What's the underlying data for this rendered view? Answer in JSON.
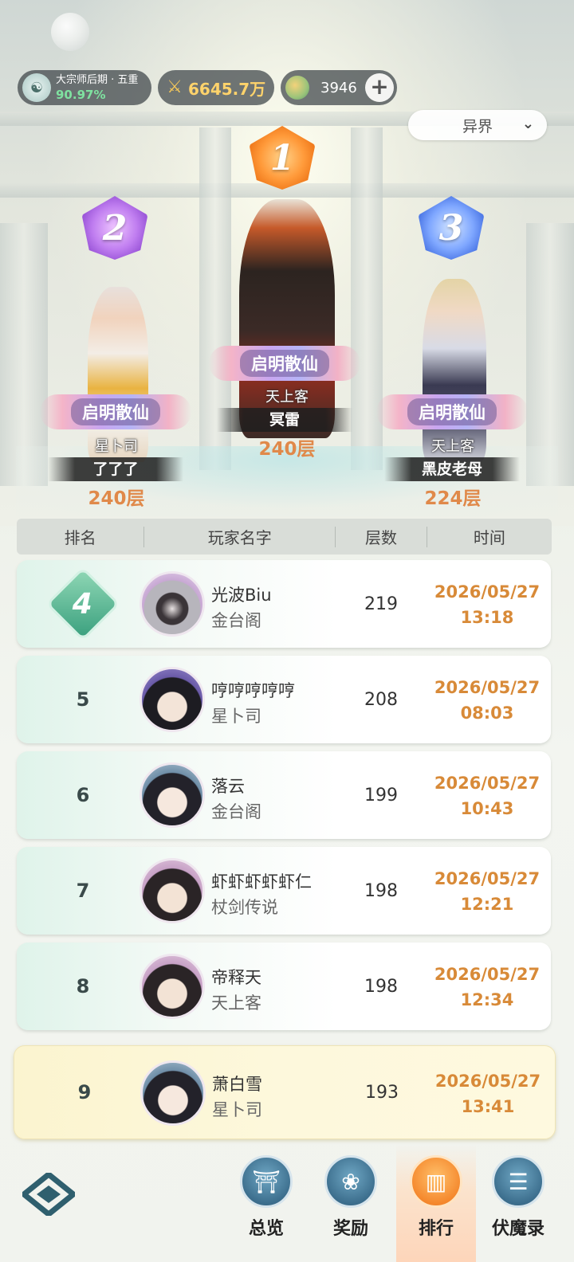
{
  "status_bar": {
    "realm_name": "大宗师后期 · 五重",
    "realm_progress": "90.97%",
    "combat_power": "6645.7万",
    "currency_amount": "3946",
    "add_label": "+"
  },
  "realm_selector": {
    "selected": "异界"
  },
  "podium": [
    {
      "rank": "1",
      "title": "启明散仙",
      "sect": "天上客",
      "player": "冥雷",
      "floor": "240层"
    },
    {
      "rank": "2",
      "title": "启明散仙",
      "sect": "星卜司",
      "player": "了了了",
      "floor": "240层"
    },
    {
      "rank": "3",
      "title": "启明散仙",
      "sect": "天上客",
      "player": "黑皮老母",
      "floor": "224层"
    }
  ],
  "table": {
    "headers": {
      "rank": "排名",
      "name": "玩家名字",
      "floor": "层数",
      "time": "时间"
    },
    "rows": [
      {
        "rank": "4",
        "name": "光波Biu",
        "sect": "金台阁",
        "floor": "219",
        "date": "2026/05/27",
        "clock": "13:18"
      },
      {
        "rank": "5",
        "name": "哼哼哼哼哼",
        "sect": "星卜司",
        "floor": "208",
        "date": "2026/05/27",
        "clock": "08:03"
      },
      {
        "rank": "6",
        "name": "落云",
        "sect": "金台阁",
        "floor": "199",
        "date": "2026/05/27",
        "clock": "10:43"
      },
      {
        "rank": "7",
        "name": "虾虾虾虾虾仁",
        "sect": "杖剑传说",
        "floor": "198",
        "date": "2026/05/27",
        "clock": "12:21"
      },
      {
        "rank": "8",
        "name": "帝释天",
        "sect": "天上客",
        "floor": "198",
        "date": "2026/05/27",
        "clock": "12:34"
      }
    ],
    "self_row": {
      "rank": "9",
      "name": "萧白雪",
      "sect": "星卜司",
      "floor": "193",
      "date": "2026/05/27",
      "clock": "13:41"
    }
  },
  "bottom_nav": {
    "items": [
      {
        "label": "总览",
        "icon": "pagoda-icon"
      },
      {
        "label": "奖励",
        "icon": "gift-icon"
      },
      {
        "label": "排行",
        "icon": "podium-icon",
        "active": true
      },
      {
        "label": "伏魔录",
        "icon": "scroll-icon"
      }
    ]
  },
  "colors": {
    "accent_orange": "#e0894a",
    "time_orange": "#d88a38",
    "progress_green": "#7fe2a0",
    "power_gold": "#ffd36b",
    "nav_active": "#f5892e"
  }
}
